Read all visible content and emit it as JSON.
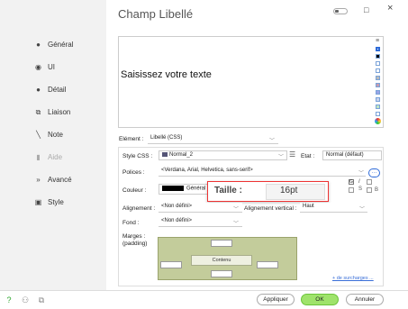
{
  "window": {
    "title": "Champ Libellé",
    "minimize": "□",
    "close": "×"
  },
  "sidebar": {
    "items": [
      {
        "label": "Général",
        "icon": "circle-icon"
      },
      {
        "label": "UI",
        "icon": "eye-icon"
      },
      {
        "label": "Détail",
        "icon": "circle-icon"
      },
      {
        "label": "Liaison",
        "icon": "link-icon"
      },
      {
        "label": "Note",
        "icon": "pen-icon"
      },
      {
        "label": "Aide",
        "icon": "help-icon"
      },
      {
        "label": "Avancé",
        "icon": "forward-icon"
      },
      {
        "label": "Style",
        "icon": "style-icon"
      }
    ]
  },
  "preview": {
    "text": "Saisissez votre texte"
  },
  "form": {
    "element_label": "Elément :",
    "element_value": "Libellé (CSS)",
    "style_css_label": "Style CSS :",
    "style_css_value": "Normal_2",
    "etat_label": "Etat :",
    "etat_value": "Normal (défaut)",
    "polices_label": "Polices :",
    "polices_value": "<Verdana, Arial, Helvetica, sans-serif>",
    "couleur_label": "Couleur :",
    "couleur_value": "Général",
    "alignement_label": "Alignement :",
    "alignement_value": "<Non défini>",
    "align_vert_label": "Alignement vertical :",
    "align_vert_value": "Haut",
    "fond_label": "Fond :",
    "fond_value": "<Non défini>",
    "marges_label": "Marges :",
    "marges_sub": "(padding)",
    "contenu": "Contenu",
    "surcharges_link": "+ de surcharges ..."
  },
  "popup": {
    "label": "Taille :",
    "value": "16pt"
  },
  "buttons": {
    "appliquer": "Appliquer",
    "ok": "OK",
    "annuler": "Annuler"
  },
  "colors": {
    "ok_green": "#9fe36b",
    "margin_green": "#c3cc9b",
    "popup_border": "#ee3333"
  }
}
